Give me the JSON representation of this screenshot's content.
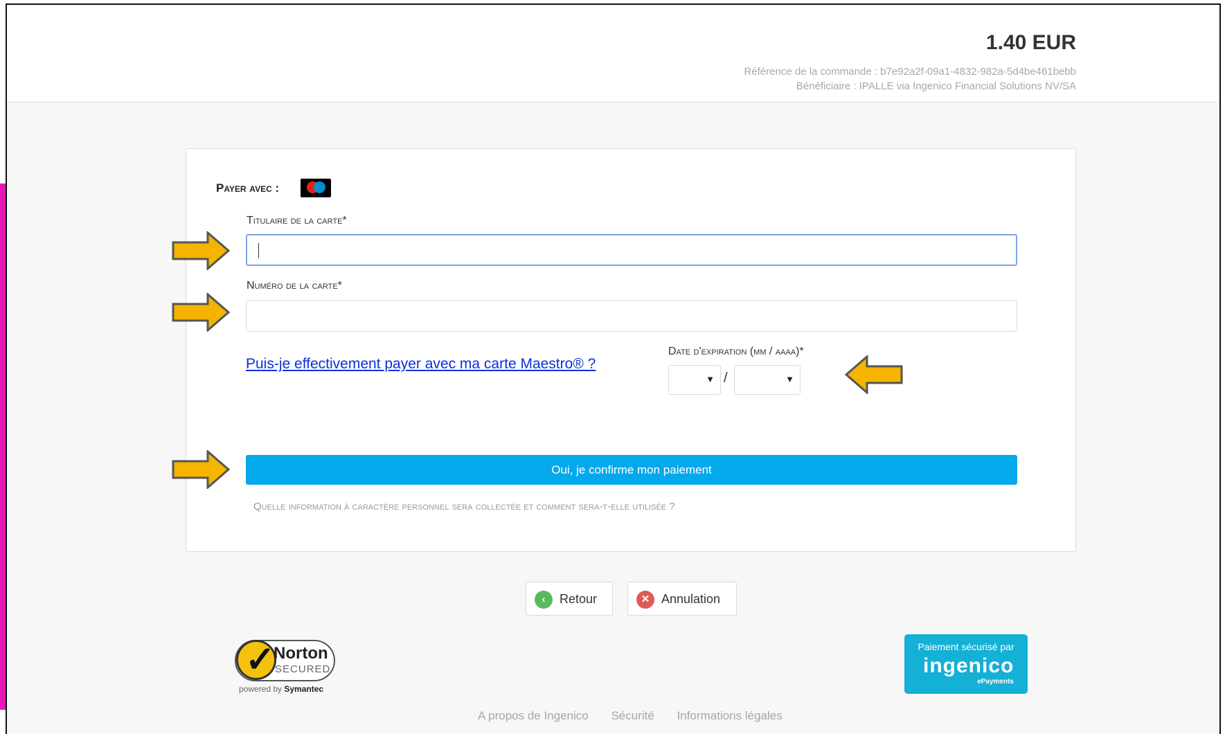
{
  "header": {
    "amount": "1.40 EUR",
    "order_reference": "Référence de la commande : b7e92a2f-09a1-4832-982a-5d4be461bebb",
    "beneficiary": "Bénéficiaire : IPALLE via Ingenico Financial Solutions NV/SA"
  },
  "form": {
    "pay_with_label": "Payer avec :",
    "card_brand": "maestro-card-icon",
    "holder_label": "Titulaire de la carte*",
    "holder_value": "",
    "number_label": "Numéro de la carte*",
    "number_value": "",
    "maestro_link": "Puis-je effectivement payer avec ma carte Maestro® ?",
    "expiry_label": "Date d'expiration (mm / aaaa)*",
    "expiry_month": "",
    "expiry_year": "",
    "expiry_separator": "/",
    "confirm_button": "Oui, je confirme mon paiement",
    "privacy_link": "Quelle information à caractère personnel sera collectée et comment sera-t-elle utilisée ?"
  },
  "actions": {
    "back_label": "Retour",
    "cancel_label": "Annulation"
  },
  "badges": {
    "norton_name": "Norton",
    "norton_secured": "SECURED",
    "norton_powered_prefix": "powered by ",
    "norton_powered_brand": "Symantec",
    "ingenico_secure": "Paiement sécurisé par",
    "ingenico_brand": "ingenico",
    "ingenico_sub": "ePayments"
  },
  "footer": {
    "links": [
      "A propos de Ingenico",
      "Sécurité",
      "Informations légales"
    ]
  },
  "colors": {
    "accent": "#04a9ec",
    "link": "#0b2fd6",
    "annotation_arrow": "#f5b400"
  }
}
